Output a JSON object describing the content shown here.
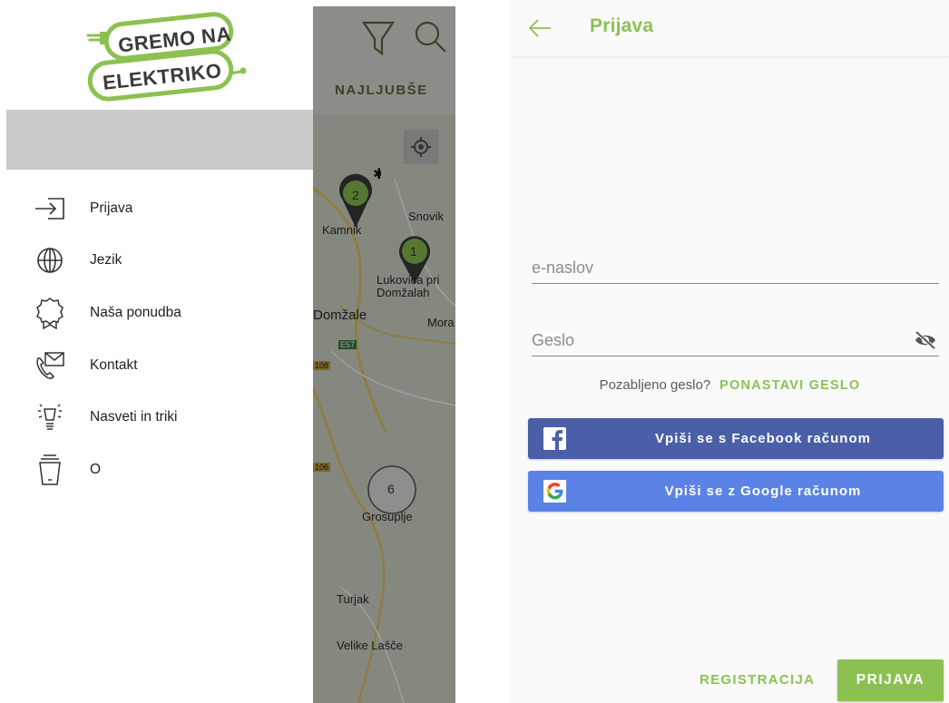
{
  "colors": {
    "brand_green": "#8cc152",
    "facebook_blue": "#4a5fa7",
    "google_blue": "#5b83e6"
  },
  "left_screen": {
    "logo": {
      "line1": "GREMO NA",
      "line2": "ELEKTRIKO"
    },
    "menu": [
      {
        "label": "Prijava",
        "icon": "login-icon"
      },
      {
        "label": "Jezik",
        "icon": "globe-icon"
      },
      {
        "label": "Naša ponudba",
        "icon": "badge-icon"
      },
      {
        "label": "Kontakt",
        "icon": "phone-mail-icon"
      },
      {
        "label": "Nasveti in triki",
        "icon": "lightbulb-icon"
      },
      {
        "label": "O",
        "icon": "cup-icon"
      }
    ],
    "map": {
      "tab_label": "NAJLJUBŠE",
      "places": [
        "Kamnik",
        "Snovik",
        "Lukovica pri Domžalah",
        "Domžale",
        "Mora",
        "Grosuplje",
        "Turjak",
        "Velike Lašče"
      ],
      "roads": [
        "E57",
        "108",
        "106"
      ],
      "clusters": [
        "2",
        "1",
        "6"
      ]
    }
  },
  "right_screen": {
    "title": "Prijava",
    "email_placeholder": "e-naslov",
    "password_placeholder": "Geslo",
    "forgot_text": "Pozabljeno geslo?",
    "reset_link": "PONASTAVI GESLO",
    "facebook_label": "Vpiši se s Facebook računom",
    "google_label": "Vpiši se z Google računom",
    "register_label": "REGISTRACIJA",
    "login_label": "PRIJAVA"
  }
}
